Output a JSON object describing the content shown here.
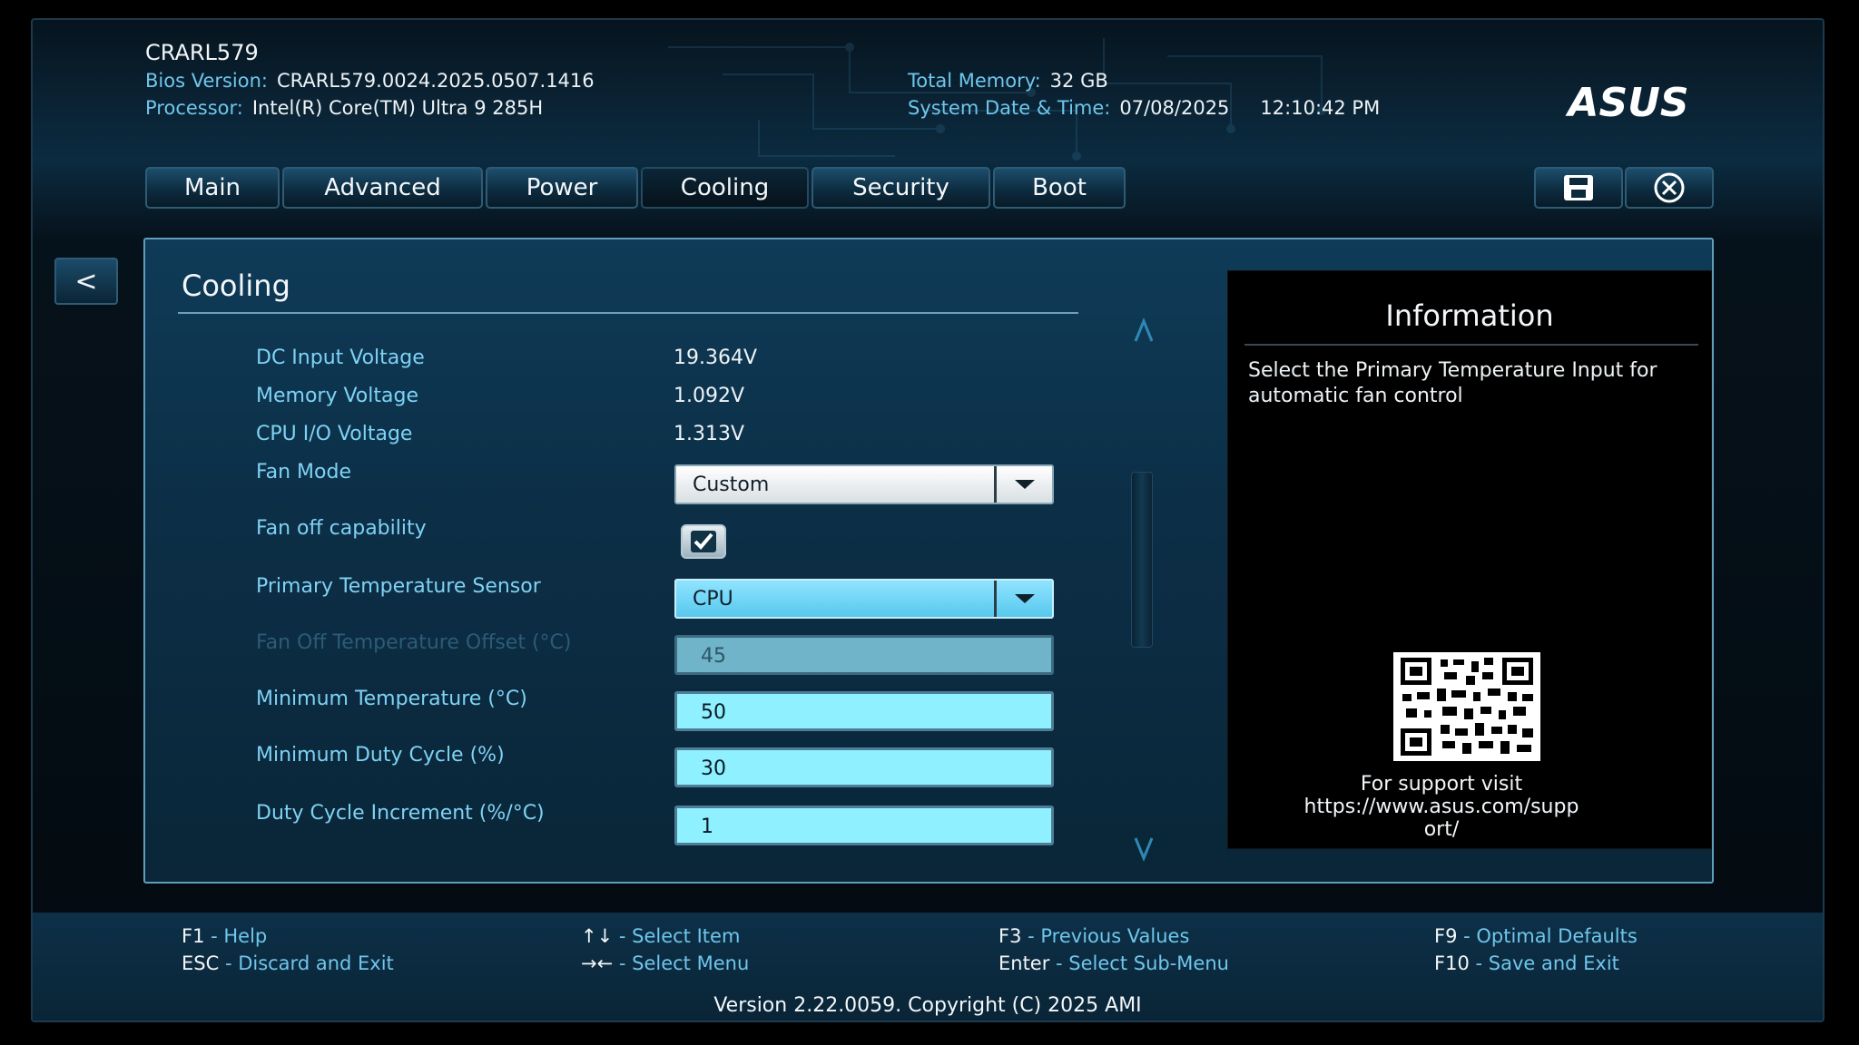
{
  "header": {
    "machine": "CRARL579",
    "bios_label": "Bios Version:",
    "bios_value": "CRARL579.0024.2025.0507.1416",
    "processor_label": "Processor:",
    "processor_value": "Intel(R) Core(TM) Ultra 9 285H",
    "memory_label": "Total Memory:",
    "memory_value": "32 GB",
    "datetime_label": "System Date & Time:",
    "date_value": "07/08/2025",
    "time_value": "12:10:42 PM",
    "logo_text": "ASUS"
  },
  "tabs": [
    {
      "label": "Main"
    },
    {
      "label": "Advanced"
    },
    {
      "label": "Power"
    },
    {
      "label": "Cooling",
      "active": true
    },
    {
      "label": "Security"
    },
    {
      "label": "Boot"
    }
  ],
  "toolbar": {
    "save_icon": "save-icon",
    "exit_icon": "close-circle-icon"
  },
  "nav": {
    "back_label": "<"
  },
  "panel": {
    "title": "Cooling",
    "rows": {
      "dc_input_voltage": {
        "label": "DC Input Voltage",
        "value": "19.364V"
      },
      "memory_voltage": {
        "label": "Memory Voltage",
        "value": "1.092V"
      },
      "cpu_io_voltage": {
        "label": "CPU I/O Voltage",
        "value": "1.313V"
      },
      "fan_mode": {
        "label": "Fan Mode",
        "value": "Custom"
      },
      "fan_off_capability": {
        "label": "Fan off capability",
        "checked": true
      },
      "primary_temp_sensor": {
        "label": "Primary Temperature Sensor",
        "value": "CPU"
      },
      "fan_off_temp_offset": {
        "label": "Fan Off Temperature Offset (°C)",
        "value": "45",
        "disabled": true
      },
      "min_temperature": {
        "label": "Minimum Temperature (°C)",
        "value": "50"
      },
      "min_duty_cycle": {
        "label": "Minimum Duty Cycle (%)",
        "value": "30"
      },
      "duty_cycle_increment": {
        "label": "Duty Cycle Increment (%/°C)",
        "value": "1"
      }
    }
  },
  "info": {
    "title": "Information",
    "text": "Select the Primary Temperature Input for automatic fan control",
    "support_line1": "For support visit",
    "support_line2": "https://www.asus.com/supp",
    "support_line3": "ort/"
  },
  "footer": {
    "f1_key": "F1",
    "f1_desc": " - Help",
    "esc_key": "ESC",
    "esc_desc": " - Discard and Exit",
    "updown_key": "↑↓",
    "updown_desc": " - Select Item",
    "leftright_key": "→←",
    "leftright_desc": " - Select Menu",
    "f3_key": "F3",
    "f3_desc": " - Previous Values",
    "enter_key": "Enter",
    "enter_desc": " - Select Sub-Menu",
    "f9_key": "F9",
    "f9_desc": " - Optimal Defaults",
    "f10_key": "F10",
    "f10_desc": " - Save and Exit",
    "version": "Version 2.22.0059. Copyright (C) 2025 AMI"
  },
  "colors": {
    "accent_text": "#7fd2f4",
    "panel_bg": "#0f3b58",
    "field_bg": "#8ff0ff",
    "selected_dropdown": "#58c8ee"
  }
}
